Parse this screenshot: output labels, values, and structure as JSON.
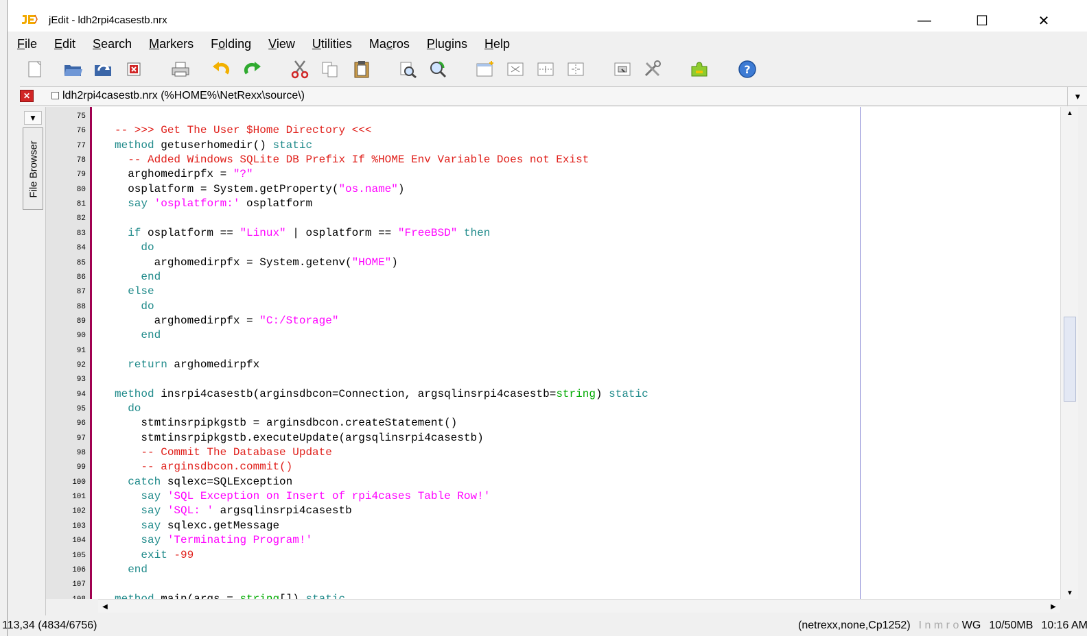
{
  "window": {
    "title": "jEdit - ldh2rpi4casestb.nrx",
    "minimize": "—",
    "maximize": "☐",
    "close": "✕"
  },
  "menu": [
    {
      "label": "File",
      "mnemonic": "F"
    },
    {
      "label": "Edit",
      "mnemonic": "E"
    },
    {
      "label": "Search",
      "mnemonic": "S"
    },
    {
      "label": "Markers",
      "mnemonic": "M"
    },
    {
      "label": "Folding",
      "mnemonic": "o"
    },
    {
      "label": "View",
      "mnemonic": "V"
    },
    {
      "label": "Utilities",
      "mnemonic": "U"
    },
    {
      "label": "Macros",
      "mnemonic": "c"
    },
    {
      "label": "Plugins",
      "mnemonic": "P"
    },
    {
      "label": "Help",
      "mnemonic": "H"
    }
  ],
  "toolbar": {
    "icons": [
      "new-file-icon",
      "open-file-icon",
      "reload-icon",
      "close-file-icon",
      "print-icon",
      "undo-icon",
      "redo-icon",
      "cut-icon",
      "copy-icon",
      "paste-icon",
      "find-icon",
      "find-next-icon",
      "new-view-icon",
      "split-horizontal-icon",
      "split-vertical-icon",
      "unsplit-icon",
      "buffer-options-icon",
      "global-options-icon",
      "plugin-manager-icon",
      "help-icon"
    ]
  },
  "buffer": {
    "label": "ldh2rpi4casestb.nrx (%HOME%\\NetRexx\\source\\)"
  },
  "dock": {
    "tab_label": "File Browser"
  },
  "editor": {
    "lines": [
      {
        "n": "75",
        "text": ""
      },
      {
        "n": "76",
        "text": "-- >>> Get The User $Home Directory <<<"
      },
      {
        "n": "77",
        "text": "method getuserhomedir() static"
      },
      {
        "n": "78",
        "text": "  -- Added Windows SQLite DB Prefix If %HOME Env Variable Does not Exist"
      },
      {
        "n": "79",
        "text": "  arghomedirpfx = \"?\""
      },
      {
        "n": "80",
        "text": "  osplatform = System.getProperty(\"os.name\")"
      },
      {
        "n": "81",
        "text": "  say 'osplatform:' osplatform"
      },
      {
        "n": "82",
        "text": ""
      },
      {
        "n": "83",
        "text": "  if osplatform == \"Linux\" | osplatform == \"FreeBSD\" then"
      },
      {
        "n": "84",
        "text": "    do"
      },
      {
        "n": "85",
        "text": "      arghomedirpfx = System.getenv(\"HOME\")"
      },
      {
        "n": "86",
        "text": "    end"
      },
      {
        "n": "87",
        "text": "  else"
      },
      {
        "n": "88",
        "text": "    do"
      },
      {
        "n": "89",
        "text": "      arghomedirpfx = \"C:/Storage\""
      },
      {
        "n": "90",
        "text": "    end"
      },
      {
        "n": "91",
        "text": ""
      },
      {
        "n": "92",
        "text": "  return arghomedirpfx"
      },
      {
        "n": "93",
        "text": ""
      },
      {
        "n": "94",
        "text": "method insrpi4casestb(arginsdbcon=Connection, argsqlinsrpi4casestb=string) static"
      },
      {
        "n": "95",
        "text": "  do"
      },
      {
        "n": "96",
        "text": "    stmtinsrpipkgstb = arginsdbcon.createStatement()"
      },
      {
        "n": "97",
        "text": "    stmtinsrpipkgstb.executeUpdate(argsqlinsrpi4casestb)"
      },
      {
        "n": "98",
        "text": "    -- Commit The Database Update"
      },
      {
        "n": "99",
        "text": "    -- arginsdbcon.commit()"
      },
      {
        "n": "100",
        "text": "  catch sqlexc=SQLException"
      },
      {
        "n": "101",
        "text": "    say 'SQL Exception on Insert of rpi4cases Table Row!'"
      },
      {
        "n": "102",
        "text": "    say 'SQL: ' argsqlinsrpi4casestb"
      },
      {
        "n": "103",
        "text": "    say sqlexc.getMessage"
      },
      {
        "n": "104",
        "text": "    say 'Terminating Program!'"
      },
      {
        "n": "105",
        "text": "    exit -99"
      },
      {
        "n": "106",
        "text": "  end"
      },
      {
        "n": "107",
        "text": ""
      },
      {
        "n": "108",
        "text": "method main(args = string[]) static"
      }
    ]
  },
  "status": {
    "position": "113,34 (4834/6756)",
    "mode": "(netrexx,none,Cp1252)",
    "flags": "I n m r o",
    "flags_active": "WG",
    "memory": "10/50MB",
    "time": "10:16 AM"
  },
  "colors": {
    "comment": "#e0201b",
    "keyword": "#1f8a8a",
    "string": "#ff00ff",
    "type": "#00aa00",
    "gutter_mark": "#a00050"
  }
}
